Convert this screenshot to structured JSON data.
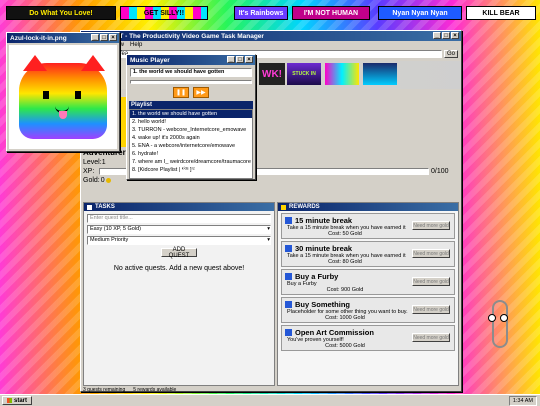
{
  "banners": [
    "Do What You Love!",
    "GET SILLY!!",
    "It's Rainbows",
    "I'M NOT HUMAN",
    "Nyan Nyan Nyan",
    "KILL BEAR"
  ],
  "main_window": {
    "title": "ST - The Productivity Video Game Task Manager",
    "menu": [
      "iew",
      "Help"
    ],
    "address_value": "Yea",
    "go_label": "Go",
    "thumbs": [
      "WK!",
      "STUCK IN",
      "",
      ""
    ]
  },
  "image_window": {
    "title": "Azul-lock-it-in.png"
  },
  "player": {
    "title": "Music Player",
    "now_playing": "1. the world we should have gotten",
    "playlist_title": "Playlist",
    "tracks": [
      "1. the world we should have gotten",
      "2. hello world!",
      "3. TURRON - webcore_Internetcore_emowave",
      "4. wake up! it's 2000s again",
      "5. ENA - a webcore/internetcore/emowave",
      "6. hydrate!",
      "7. where am I_ weirdcore/dreamcore/traumacore",
      "8. [Kidcore Playlist | ᵏⁱᵈˢ ]ʳᶻ"
    ]
  },
  "character": {
    "name": "Adventurer",
    "level_label": "Level:",
    "level": "1",
    "xp_label": "XP:",
    "xp_text": "0/100",
    "xp_fraction": 0,
    "gold_label": "Gold:",
    "gold": "0"
  },
  "tasks": {
    "header": "TASKS",
    "title_placeholder": "Enter quest title...",
    "difficulty": "Easy (10 XP, 5 Gold)",
    "priority": "Medium Priority",
    "add_label": "ADD QUEST",
    "empty_text": "No active quests. Add a new quest above!"
  },
  "rewards": {
    "header": "REWARDS",
    "items": [
      {
        "title": "15 minute break",
        "desc": "Take a 15 minute break when you have earned it",
        "cost": "Cost: 50 Gold",
        "button": "Need more gold"
      },
      {
        "title": "30 minute break",
        "desc": "Take a 15 minute break when you have earned it",
        "cost": "Cost: 80 Gold",
        "button": "Need more gold"
      },
      {
        "title": "Buy a Furby",
        "desc": "Buy a Furby",
        "cost": "Cost: 900 Gold",
        "button": "Need more gold"
      },
      {
        "title": "Buy Something",
        "desc": "Placeholder for some other thing you want to buy.",
        "cost": "Cost: 1000 Gold",
        "button": "Need more gold"
      },
      {
        "title": "Open Art Commission",
        "desc": "You've proven yourself!",
        "cost": "Cost: 5000 Gold",
        "button": "Need more gold"
      }
    ]
  },
  "status": {
    "quests": "3 quests remaining",
    "rewards": "5 rewards available"
  },
  "taskbar": {
    "start": "start",
    "time": "1:34 AM"
  }
}
